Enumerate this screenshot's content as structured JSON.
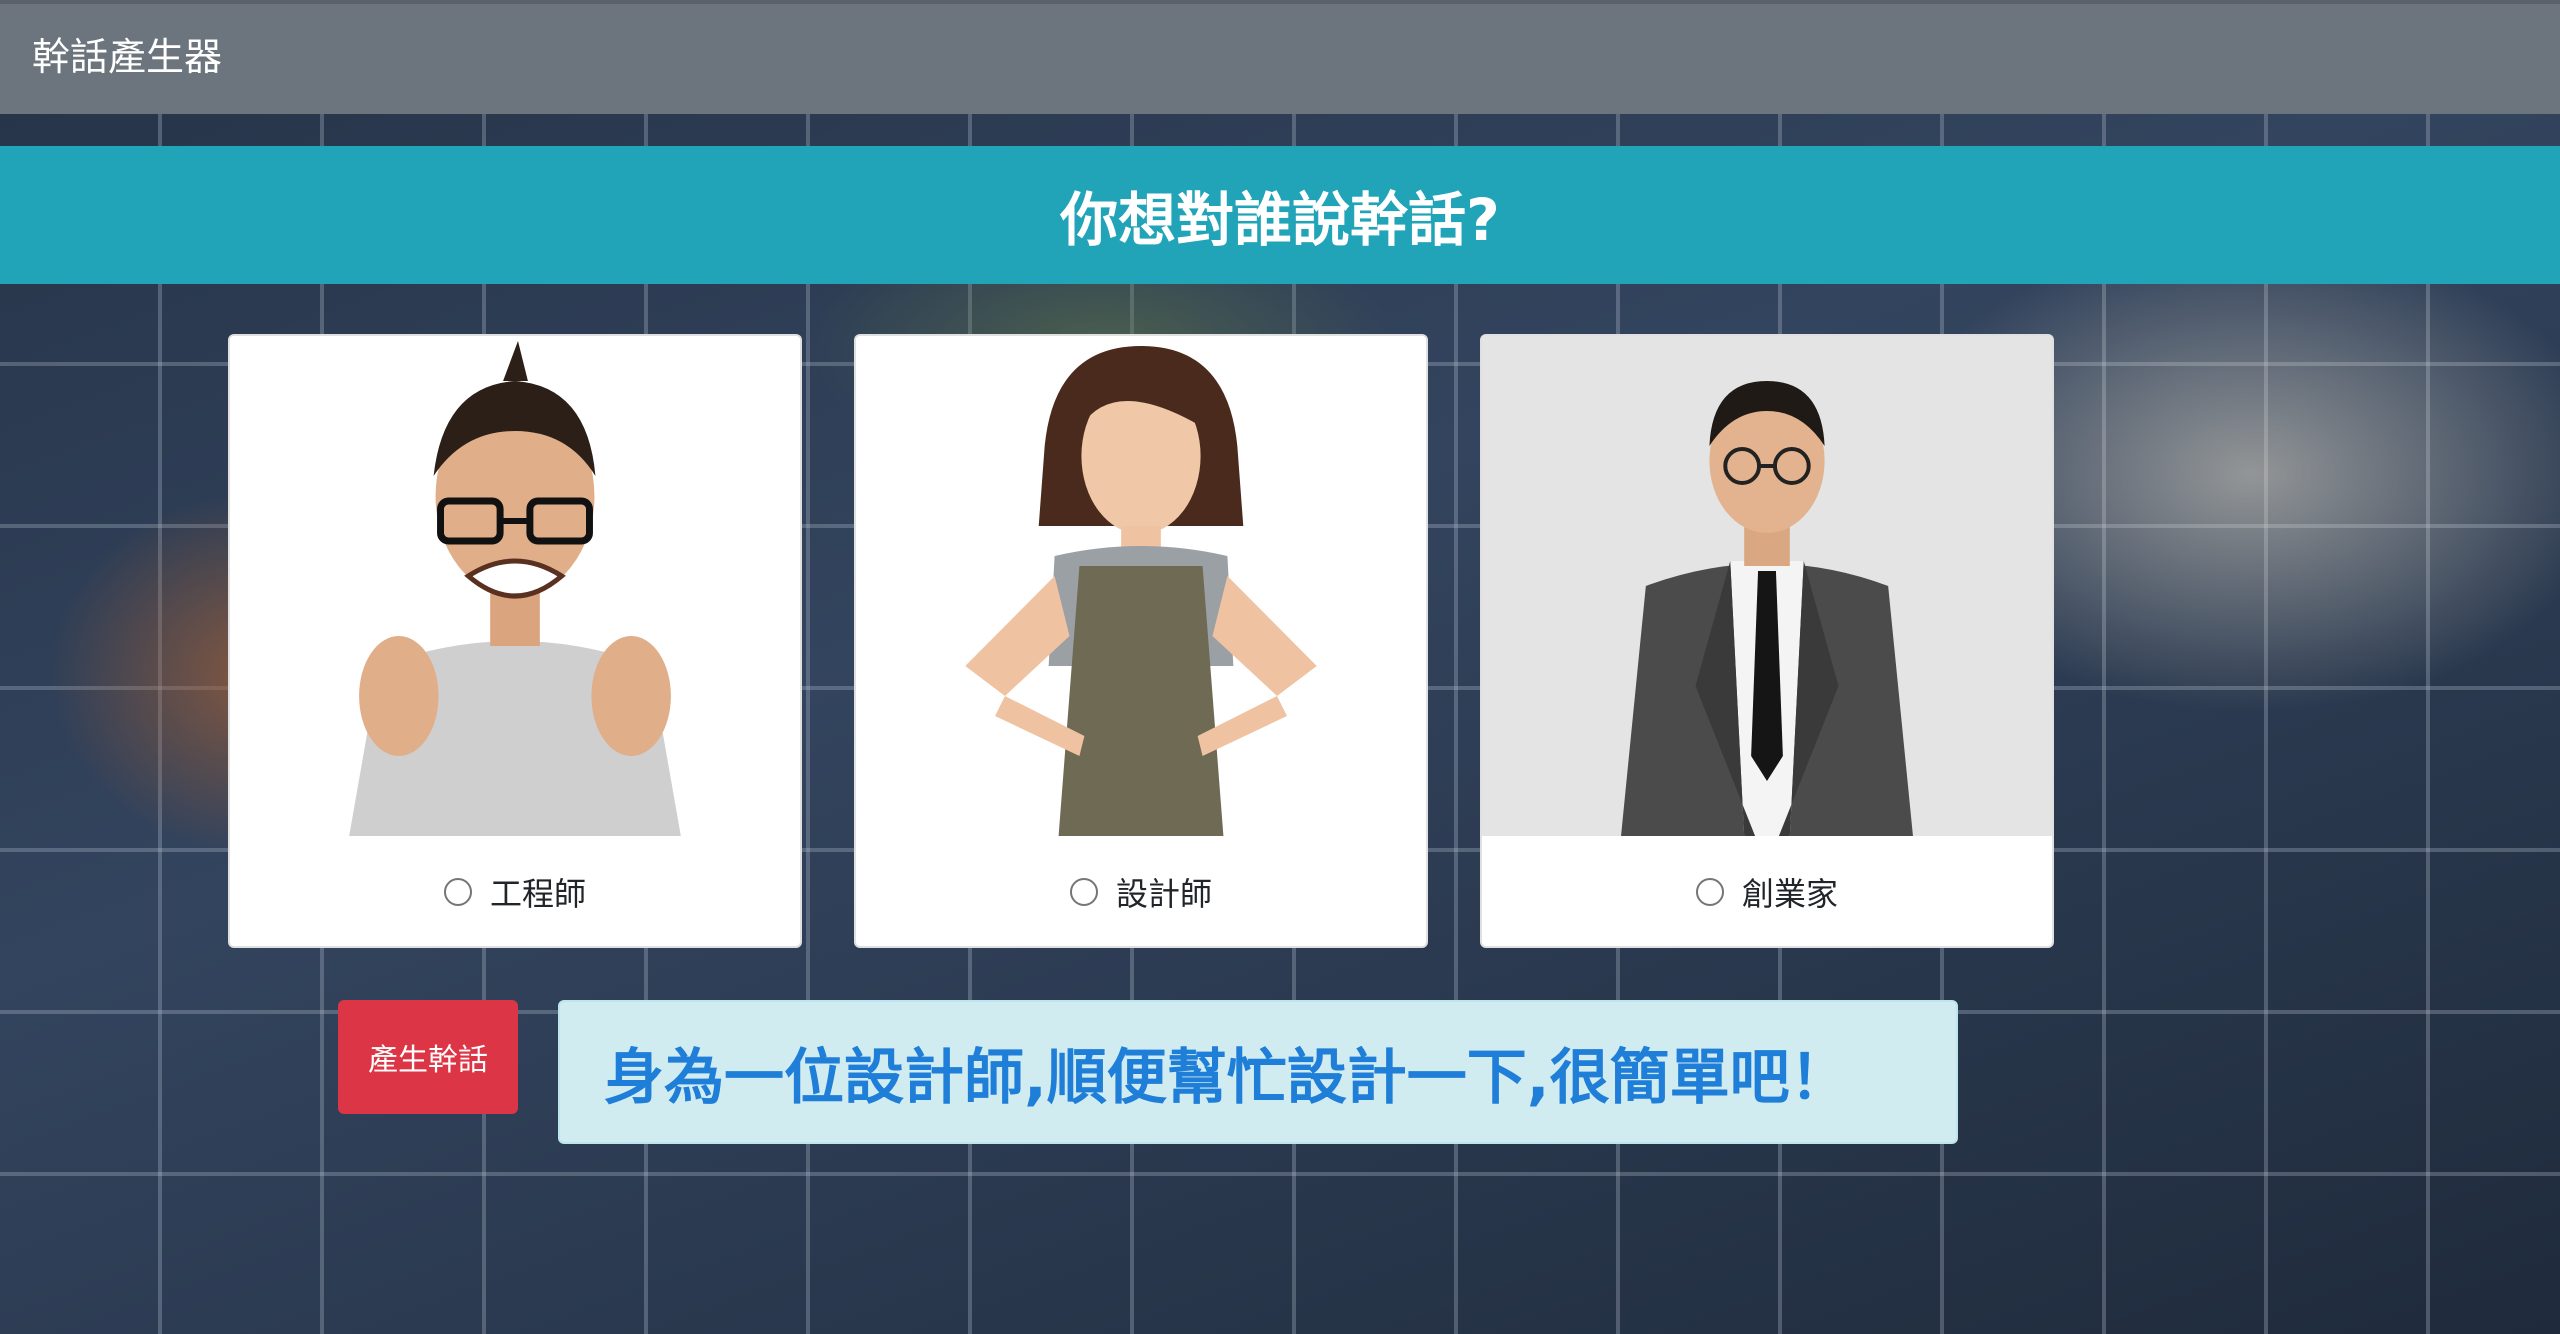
{
  "navbar": {
    "brand": "幹話產生器"
  },
  "banner": {
    "title": "你想對誰說幹話?"
  },
  "cards": [
    {
      "label": "工程師",
      "selected": false
    },
    {
      "label": "設計師",
      "selected": false
    },
    {
      "label": "創業家",
      "selected": false
    }
  ],
  "actions": {
    "generate_label": "產生幹話"
  },
  "result": {
    "text": "身為一位設計師,順便幫忙設計一下,很簡單吧！"
  },
  "colors": {
    "navbar": "#6c757d",
    "banner": "#21a3b8",
    "button": "#dc3545",
    "result_bg": "#d1ecf1",
    "result_text": "#1e7ed8"
  }
}
